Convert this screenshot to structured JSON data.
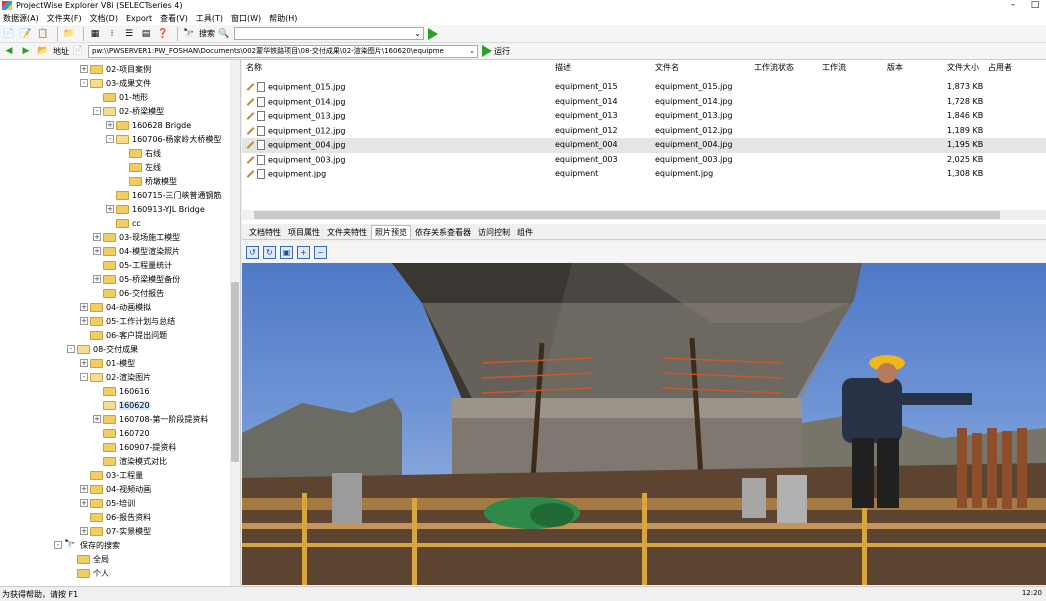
{
  "window": {
    "title": "ProjectWise Explorer V8i (SELECTseries 4)",
    "minimize": "–",
    "maximize": "□"
  },
  "menubar": [
    "数据源(A)",
    "文件夹(F)",
    "文档(D)",
    "Export",
    "查看(V)",
    "工具(T)",
    "窗口(W)",
    "帮助(H)"
  ],
  "toolbar": {
    "search_label": "搜索",
    "search_value": ""
  },
  "addressbar": {
    "label": "地址",
    "path": "pw:\\\\PWSERVER1:PW_FOSHAN\\Documents\\002蒙华铁路项目\\08-交付成果\\02-渲染图片\\160620\\equipme",
    "run_label": "运行"
  },
  "tree": [
    {
      "label": "02-项目案例",
      "indent": 1,
      "exp": "+",
      "icon": "folder"
    },
    {
      "label": "03-成果文件",
      "indent": 1,
      "exp": "-",
      "icon": "folder-open"
    },
    {
      "label": "01-地形",
      "indent": 2,
      "exp": "",
      "icon": "folder"
    },
    {
      "label": "02-桥梁模型",
      "indent": 2,
      "exp": "-",
      "icon": "folder-open"
    },
    {
      "label": "160628 Brigde",
      "indent": 3,
      "exp": "+",
      "icon": "folder"
    },
    {
      "label": "160706-杨家岭大桥模型",
      "indent": 3,
      "exp": "-",
      "icon": "folder-open"
    },
    {
      "label": "右线",
      "indent": 4,
      "exp": "",
      "icon": "folder"
    },
    {
      "label": "左线",
      "indent": 4,
      "exp": "",
      "icon": "folder"
    },
    {
      "label": "桥墩模型",
      "indent": 4,
      "exp": "",
      "icon": "folder"
    },
    {
      "label": "160715-三门峡普通钢筋",
      "indent": 3,
      "exp": "",
      "icon": "folder"
    },
    {
      "label": "160913-YJL Bridge",
      "indent": 3,
      "exp": "+",
      "icon": "folder"
    },
    {
      "label": "cc",
      "indent": 3,
      "exp": "",
      "icon": "folder"
    },
    {
      "label": "03-现场施工模型",
      "indent": 2,
      "exp": "+",
      "icon": "folder"
    },
    {
      "label": "04-模型渲染照片",
      "indent": 2,
      "exp": "+",
      "icon": "folder"
    },
    {
      "label": "05-工程量统计",
      "indent": 2,
      "exp": "",
      "icon": "folder"
    },
    {
      "label": "05-桥梁模型备份",
      "indent": 2,
      "exp": "+",
      "icon": "folder"
    },
    {
      "label": "06-交付报告",
      "indent": 2,
      "exp": "",
      "icon": "folder"
    },
    {
      "label": "04-动画模拟",
      "indent": 1,
      "exp": "+",
      "icon": "folder"
    },
    {
      "label": "05-工作计划与总结",
      "indent": 1,
      "exp": "+",
      "icon": "folder"
    },
    {
      "label": "06-客户提出问题",
      "indent": 1,
      "exp": "",
      "icon": "folder"
    },
    {
      "label": "08-交付成果",
      "indent": 0,
      "exp": "-",
      "icon": "folder-open"
    },
    {
      "label": "01-模型",
      "indent": 1,
      "exp": "+",
      "icon": "folder"
    },
    {
      "label": "02-渲染图片",
      "indent": 1,
      "exp": "-",
      "icon": "folder-open"
    },
    {
      "label": "160616",
      "indent": 2,
      "exp": "",
      "icon": "folder"
    },
    {
      "label": "160620",
      "indent": 2,
      "exp": "",
      "icon": "folder-open",
      "selected": true
    },
    {
      "label": "160708-第一阶段提资料",
      "indent": 2,
      "exp": "+",
      "icon": "folder"
    },
    {
      "label": "160720",
      "indent": 2,
      "exp": "",
      "icon": "folder"
    },
    {
      "label": "160907-提资料",
      "indent": 2,
      "exp": "",
      "icon": "folder"
    },
    {
      "label": "渲染模式对比",
      "indent": 2,
      "exp": "",
      "icon": "folder"
    },
    {
      "label": "03-工程量",
      "indent": 1,
      "exp": "",
      "icon": "folder"
    },
    {
      "label": "04-视频动画",
      "indent": 1,
      "exp": "+",
      "icon": "folder"
    },
    {
      "label": "05-培训",
      "indent": 1,
      "exp": "+",
      "icon": "folder"
    },
    {
      "label": "06-报告资料",
      "indent": 1,
      "exp": "",
      "icon": "folder"
    },
    {
      "label": "07-实景模型",
      "indent": 1,
      "exp": "+",
      "icon": "folder"
    },
    {
      "label": "保存的搜索",
      "indent": -1,
      "exp": "-",
      "icon": "search"
    },
    {
      "label": "全局",
      "indent": 0,
      "exp": "",
      "icon": "star"
    },
    {
      "label": "个人",
      "indent": 0,
      "exp": "",
      "icon": "star"
    }
  ],
  "filelist": {
    "columns": [
      "名称",
      "描述",
      "文件名",
      "工作流状态",
      "工作流",
      "版本",
      "文件大小",
      "占用者"
    ],
    "rows": [
      {
        "name": "equipment_015.jpg",
        "desc": "equipment_015",
        "filename": "equipment_015.jpg",
        "size": "1,873 KB"
      },
      {
        "name": "equipment_014.jpg",
        "desc": "equipment_014",
        "filename": "equipment_014.jpg",
        "size": "1,728 KB"
      },
      {
        "name": "equipment_013.jpg",
        "desc": "equipment_013",
        "filename": "equipment_013.jpg",
        "size": "1,846 KB"
      },
      {
        "name": "equipment_012.jpg",
        "desc": "equipment_012",
        "filename": "equipment_012.jpg",
        "size": "1,189 KB"
      },
      {
        "name": "equipment_004.jpg",
        "desc": "equipment_004",
        "filename": "equipment_004.jpg",
        "size": "1,195 KB",
        "highlight": true
      },
      {
        "name": "equipment_003.jpg",
        "desc": "equipment_003",
        "filename": "equipment_003.jpg",
        "size": "2,025 KB"
      },
      {
        "name": "equipment.jpg",
        "desc": "equipment",
        "filename": "equipment.jpg",
        "size": "1,308 KB"
      }
    ]
  },
  "tabs": [
    {
      "label": "文档特性"
    },
    {
      "label": "项目属性"
    },
    {
      "label": "文件夹特性"
    },
    {
      "label": "照片预览",
      "active": true
    },
    {
      "label": "依存关系查看器"
    },
    {
      "label": "访问控制"
    },
    {
      "label": "组件"
    }
  ],
  "statusbar": {
    "text": "为获得帮助，请按 F1",
    "clock": "12:20"
  }
}
